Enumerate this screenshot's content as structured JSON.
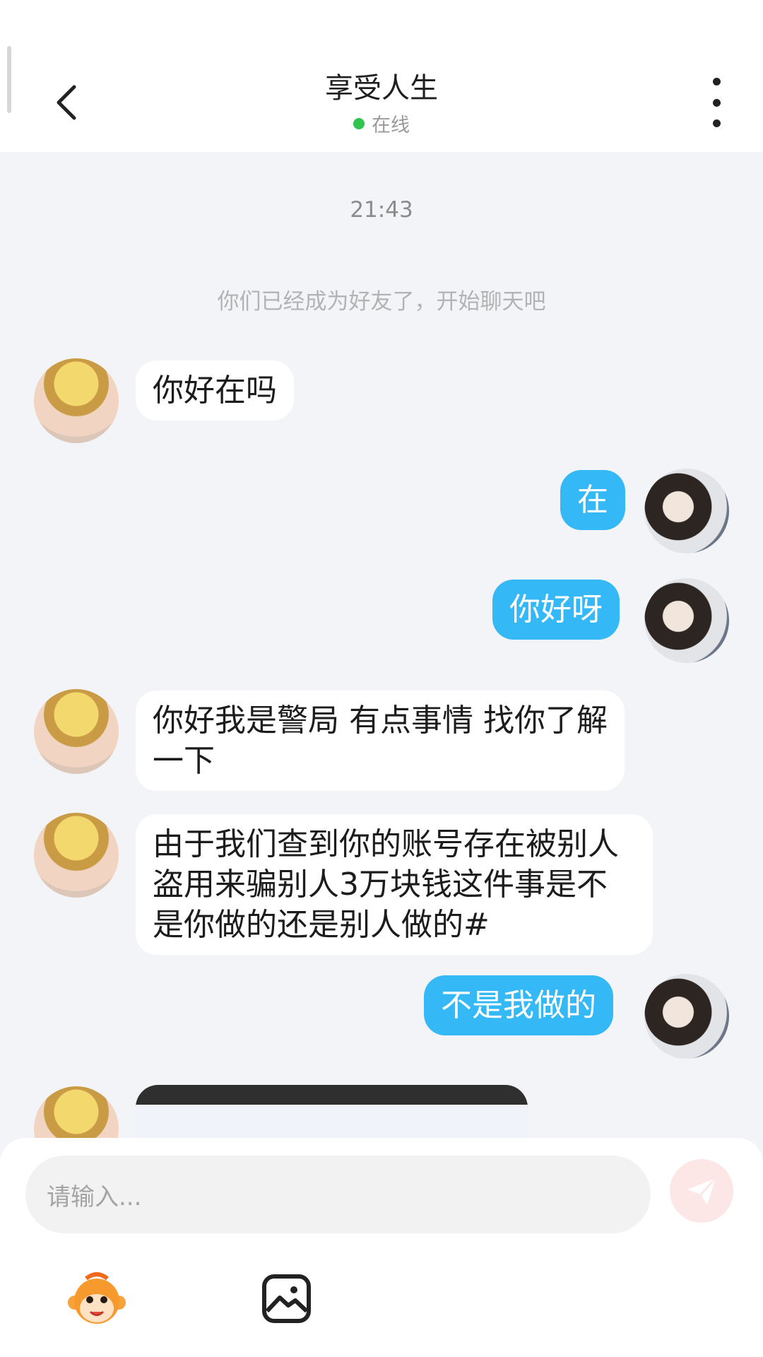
{
  "header": {
    "title": "享受人生",
    "status": "在线",
    "status_color": "#2ec44d"
  },
  "chat": {
    "timestamp": "21:43",
    "system_notice": "你们已经成为好友了，开始聊天吧",
    "messages": [
      {
        "side": "left",
        "text": "你好在吗"
      },
      {
        "side": "right",
        "text": "在"
      },
      {
        "side": "right",
        "text": "你好呀"
      },
      {
        "side": "left",
        "text": "你好我是警局 有点事情 找你了解一下"
      },
      {
        "side": "left",
        "text": "由于我们查到你的账号存在被别人盗用来骗别人3万块钱这件事是不是你做的还是别人做的#"
      },
      {
        "side": "right",
        "text": "不是我做的"
      }
    ]
  },
  "input": {
    "placeholder": "请输入..."
  },
  "colors": {
    "accent": "#35b8f6",
    "background": "#f3f4f8",
    "send_button": "#fde6e6"
  },
  "icons": {
    "back": "chevron-left-icon",
    "more": "more-vertical-icon",
    "send": "send-icon",
    "emoji": "emoji-monkey-icon",
    "image": "image-icon"
  }
}
